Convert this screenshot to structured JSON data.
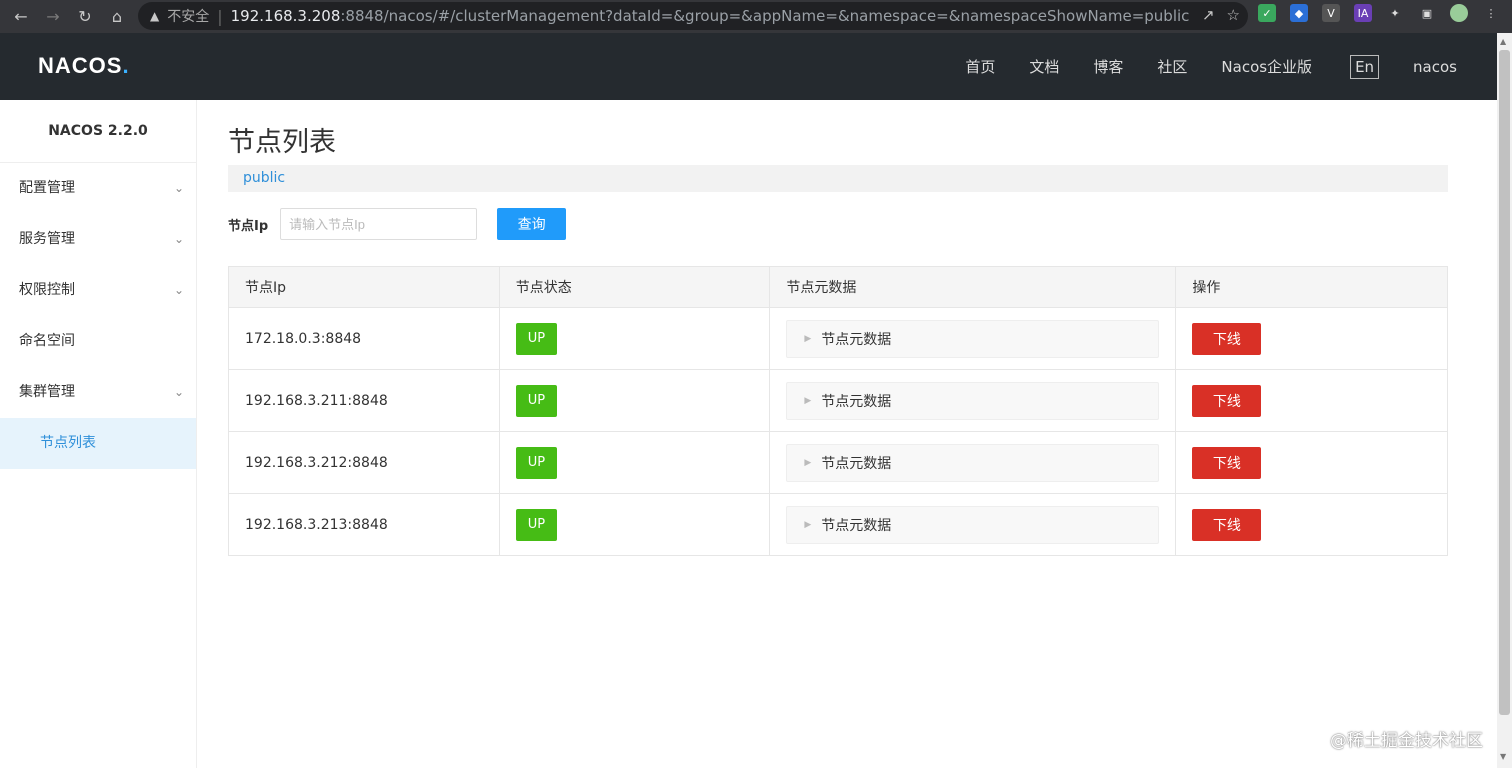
{
  "browser": {
    "insecure_label": "不安全",
    "url_host": "192.168.3.208",
    "url_rest": ":8848/nacos/#/clusterManagement?dataId=&group=&appName=&namespace=&namespaceShowName=public"
  },
  "header": {
    "logo": "NACOS",
    "logo_dot": ".",
    "nav": [
      "首页",
      "文档",
      "博客",
      "社区",
      "Nacos企业版"
    ],
    "lang": "En",
    "user": "nacos"
  },
  "sidebar": {
    "version": "NACOS 2.2.0",
    "items": [
      {
        "label": "配置管理",
        "expandable": true
      },
      {
        "label": "服务管理",
        "expandable": true
      },
      {
        "label": "权限控制",
        "expandable": true
      },
      {
        "label": "命名空间",
        "expandable": false
      },
      {
        "label": "集群管理",
        "expandable": true
      }
    ],
    "active_sub": "节点列表"
  },
  "main": {
    "title": "节点列表",
    "namespace": "public",
    "search": {
      "label": "节点Ip",
      "placeholder": "请输入节点Ip",
      "button": "查询"
    },
    "table": {
      "headers": [
        "节点Ip",
        "节点状态",
        "节点元数据",
        "操作"
      ],
      "rows": [
        {
          "ip": "172.18.0.3:8848",
          "status": "UP",
          "meta": "节点元数据",
          "action": "下线"
        },
        {
          "ip": "192.168.3.211:8848",
          "status": "UP",
          "meta": "节点元数据",
          "action": "下线"
        },
        {
          "ip": "192.168.3.212:8848",
          "status": "UP",
          "meta": "节点元数据",
          "action": "下线"
        },
        {
          "ip": "192.168.3.213:8848",
          "status": "UP",
          "meta": "节点元数据",
          "action": "下线"
        }
      ]
    }
  },
  "watermark": "@稀土掘金技术社区",
  "colors": {
    "header_bg": "#252a2f",
    "primary": "#209bfa",
    "status_up": "#46bc15",
    "danger": "#d93026",
    "link": "#2e8fd9"
  }
}
